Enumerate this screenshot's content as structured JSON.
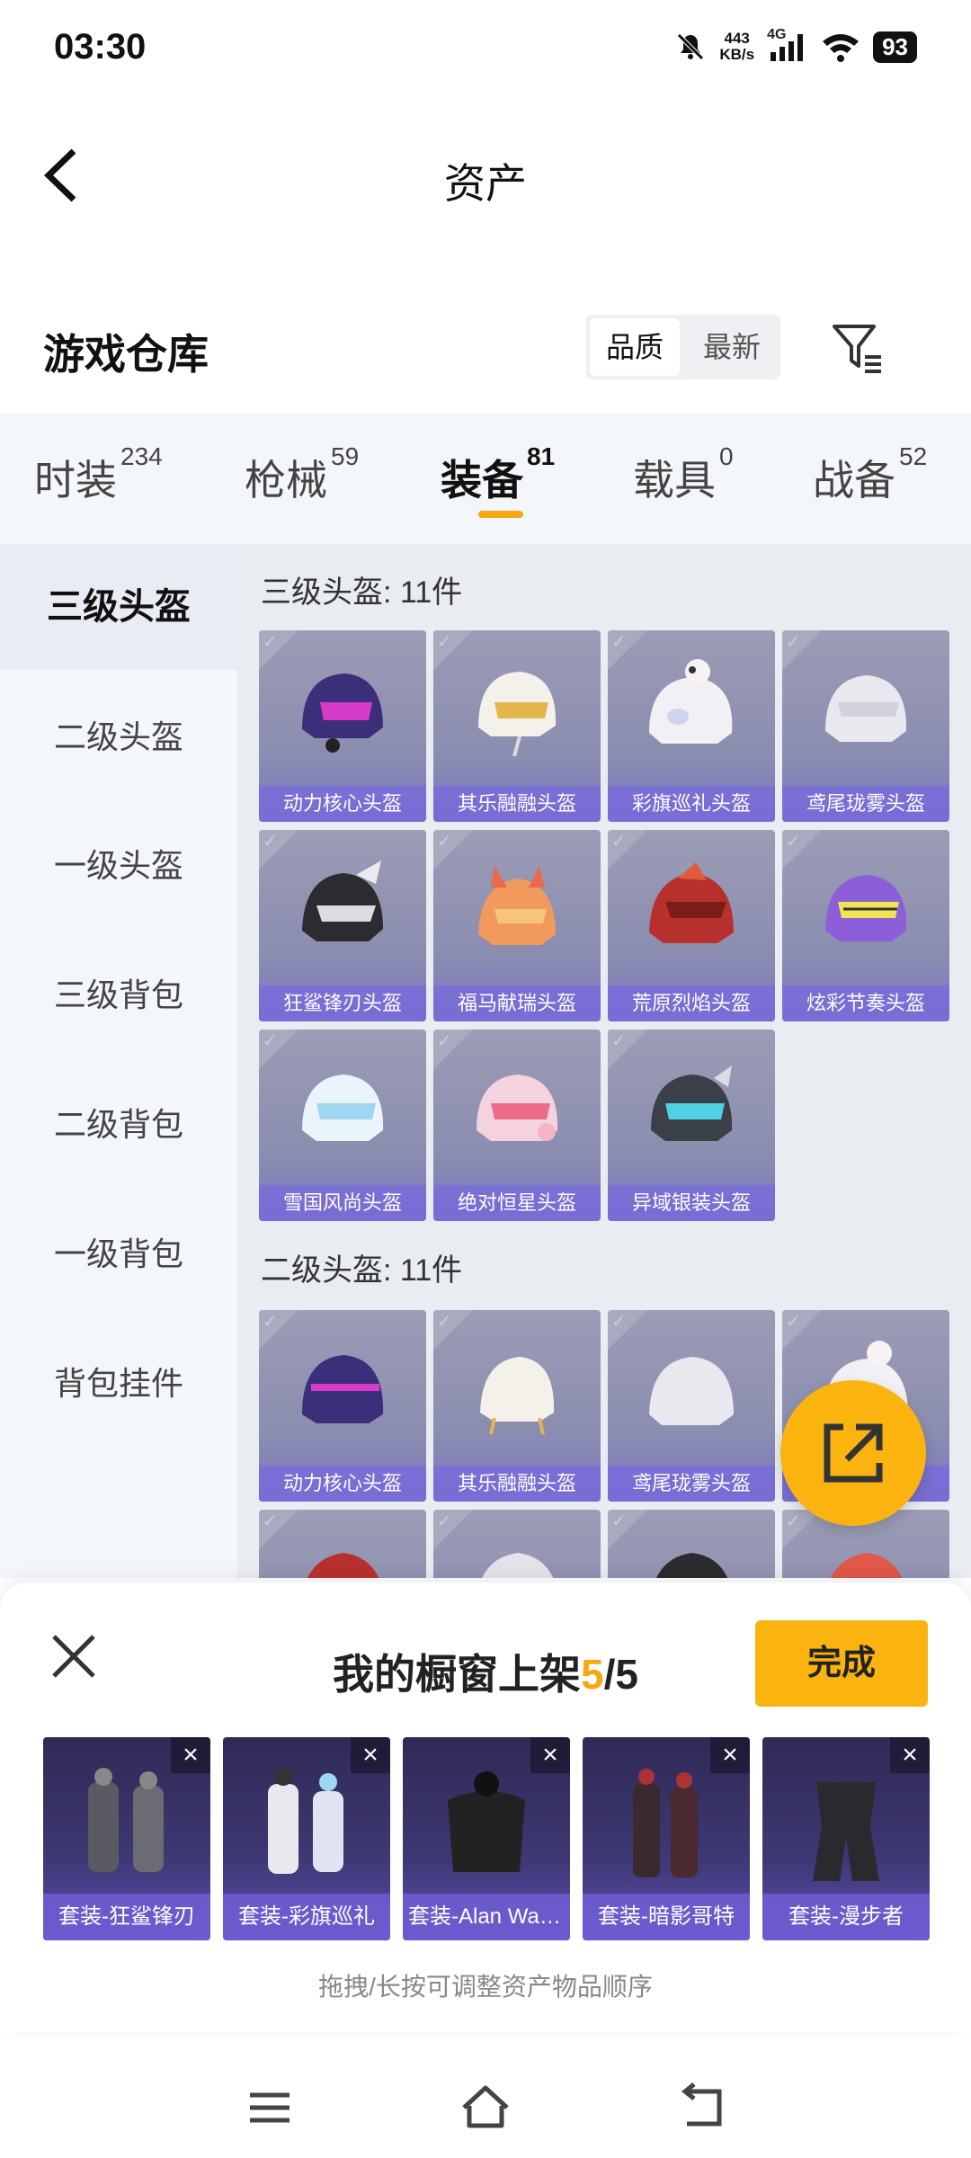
{
  "status_bar": {
    "time": "03:30",
    "net_speed_value": "443",
    "net_speed_unit": "KB/s",
    "network": "4G",
    "battery": "93"
  },
  "header": {
    "title": "资产"
  },
  "warehouse": {
    "title": "游戏仓库",
    "sort_options": [
      "品质",
      "最新"
    ],
    "active_sort": "品质"
  },
  "tabs": [
    {
      "label": "时装",
      "count": "234"
    },
    {
      "label": "枪械",
      "count": "59"
    },
    {
      "label": "装备",
      "count": "81"
    },
    {
      "label": "载具",
      "count": "0"
    },
    {
      "label": "战备",
      "count": "52"
    }
  ],
  "active_tab": "装备",
  "side_nav": [
    "三级头盔",
    "二级头盔",
    "一级头盔",
    "三级背包",
    "二级背包",
    "一级背包",
    "背包挂件"
  ],
  "sections": [
    {
      "title": "三级头盔: 11件",
      "items": [
        "动力核心头盔",
        "其乐融融头盔",
        "彩旗巡礼头盔",
        "鸢尾珑雾头盔",
        "狂鲨锋刃头盔",
        "福马献瑞头盔",
        "荒原烈焰头盔",
        "炫彩节奏头盔",
        "雪国风尚头盔",
        "绝对恒星头盔",
        "异域银装头盔"
      ]
    },
    {
      "title": "二级头盔: 11件",
      "items": [
        "动力核心头盔",
        "其乐融融头盔",
        "鸢尾珑雾头盔",
        "",
        "",
        "",
        "",
        ""
      ]
    }
  ],
  "showcase": {
    "title_prefix": "我的橱窗上架",
    "current": "5",
    "total": "/5",
    "done_label": "完成",
    "slots": [
      "套装-狂鲨锋刃",
      "套装-彩旗巡礼",
      "套装-Alan Walker",
      "套装-暗影哥特",
      "套装-漫步者"
    ],
    "hint": "拖拽/长按可调整资产物品顺序"
  },
  "colors": {
    "accent": "#fbb40f",
    "card_label": "#7869dc"
  }
}
